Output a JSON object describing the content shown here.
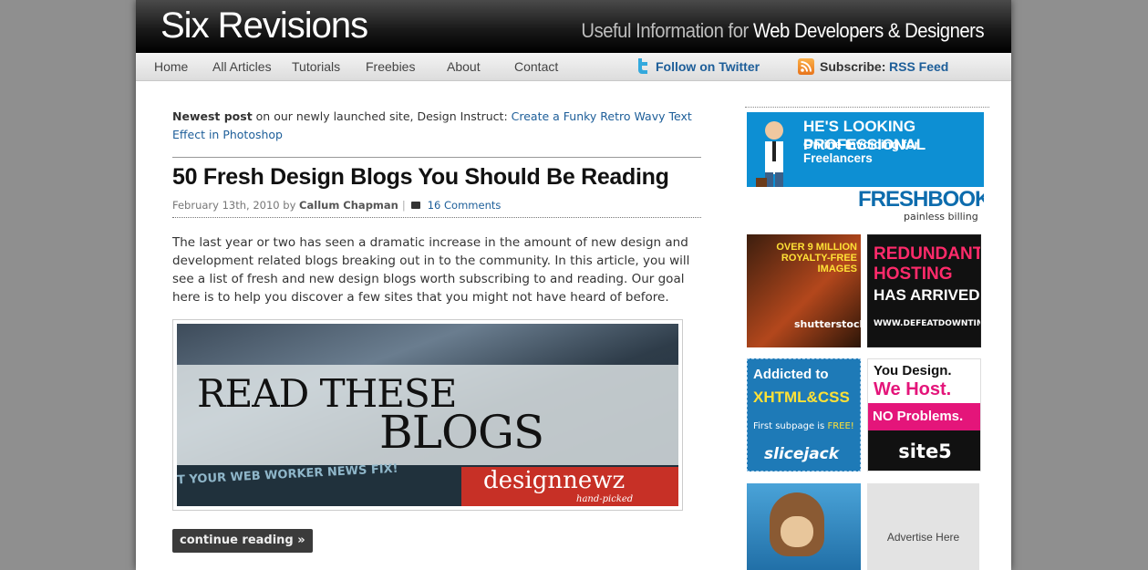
{
  "header": {
    "logo": "Six Revisions",
    "tagline_prefix": "Useful Information for",
    "tagline_suffix": "Web Developers & Designers"
  },
  "nav": {
    "items": [
      "Home",
      "All Articles",
      "Tutorials",
      "Freebies",
      "About",
      "Contact"
    ],
    "twitter_label": "Follow on Twitter",
    "subscribe_label": "Subscribe:",
    "rss_label": "RSS Feed"
  },
  "newest": {
    "lead": "Newest post",
    "text": " on our newly launched site, Design Instruct: ",
    "link": "Create a Funky Retro Wavy Text Effect in Photoshop"
  },
  "post": {
    "title": "50 Fresh Design Blogs You Should Be Reading",
    "date": "February 13th, 2010",
    "by": " by ",
    "author": "Callum Chapman",
    "comments": "16 Comments",
    "excerpt": "The last year or two has seen a dramatic increase in the amount of new design and development related blogs breaking out in to the community. In this article, you will see a list of fresh and new design blogs worth subscribing to and reading. Our goal here is to help you discover a few sites that you might not have heard of before.",
    "image_line1": "READ THESE",
    "image_line2": "BLOGS",
    "image_strip": "T YOUR WEB WORKER NEWS FIX!",
    "image_brand": "designnewz",
    "image_brand_sub": "hand-picked",
    "continue_label": "continue reading »"
  },
  "ads": {
    "freshbooks": {
      "line1": "HE'S LOOKING PROFESSIONAL",
      "line2": "Online Invoicing for Freelancers",
      "brand": "FRESHBOOKS",
      "sub": "painless billing"
    },
    "shutterstock": {
      "text": "OVER 9 MILLION ROYALTY-FREE IMAGES",
      "brand": "shutterstock"
    },
    "defeatdowntime": {
      "line1": "REDUNDANT HOSTING",
      "line2": "HAS ARRIVED",
      "url": "WWW.DEFEATDOWNTIME.COM"
    },
    "slicejack": {
      "line1": "Addicted to",
      "line2": "XHTML&CSS",
      "line3_pre": "First subpage is ",
      "line3_free": "FREE!",
      "brand": "slicejack"
    },
    "site5": {
      "line1": "You Design.",
      "line2": "We Host.",
      "line3": "NO Problems.",
      "brand": "site5"
    },
    "advertise_here": "Advertise Here"
  },
  "colors": {
    "link": "#1d5e99",
    "header_bg": "#000000",
    "page_bg": "#8f8f8f"
  }
}
